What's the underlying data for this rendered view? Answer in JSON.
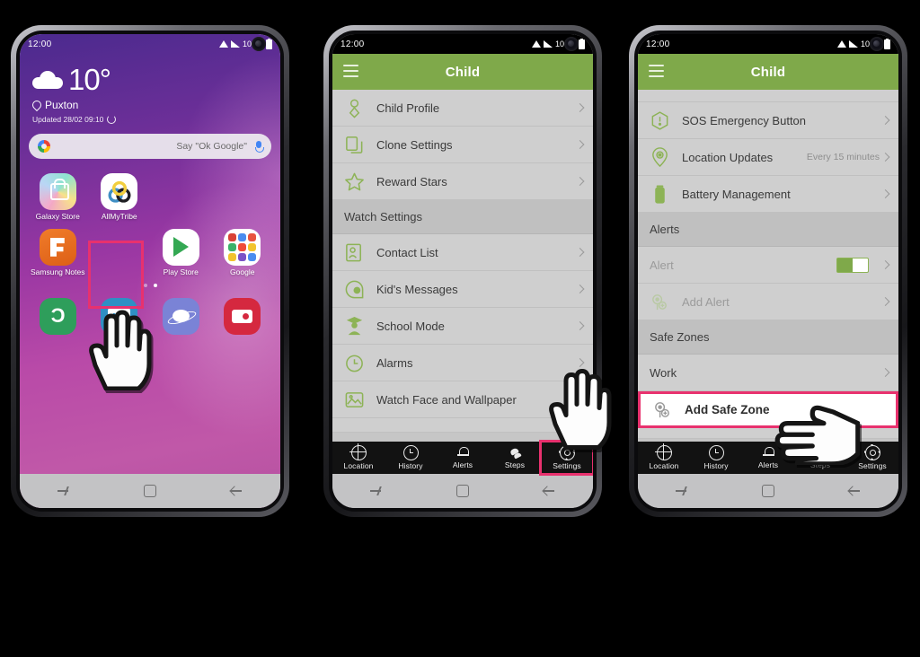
{
  "phone1": {
    "status": {
      "time": "12:00",
      "battery": "100%",
      "icons": [
        "wifi-icon",
        "signal-icon",
        "battery-icon"
      ]
    },
    "weather": {
      "temp": "10°",
      "location": "Puxton",
      "updated": "Updated 28/02 09:10",
      "condition_icon": "cloud-icon"
    },
    "search": {
      "placeholder": "Say \"Ok Google\"",
      "logo": "google-g-icon",
      "mic": "microphone-icon"
    },
    "apps": [
      {
        "label": "Galaxy Store",
        "icon": "galaxy-store-icon"
      },
      {
        "label": "AllMyTribe",
        "icon": "allmytribe-icon",
        "highlighted": true
      },
      {
        "label": "Samsung Notes",
        "icon": "samsung-notes-icon"
      },
      {
        "label": "Play Store",
        "icon": "play-store-icon"
      },
      {
        "label": "Google",
        "icon": "google-folder-icon"
      }
    ],
    "dock": [
      {
        "label": "Phone",
        "icon": "phone-icon"
      },
      {
        "label": "Messages",
        "icon": "messages-icon"
      },
      {
        "label": "Internet",
        "icon": "internet-icon"
      },
      {
        "label": "Camera",
        "icon": "camera-icon"
      }
    ],
    "page_dots": 2,
    "nav": [
      "recents-icon",
      "home-icon",
      "back-icon"
    ]
  },
  "phone2": {
    "status": {
      "time": "12:00",
      "battery": "100%"
    },
    "appbar": {
      "title": "Child",
      "menu_icon": "hamburger-menu-icon"
    },
    "rows": [
      {
        "label": "Child Profile",
        "icon": "child-profile-icon",
        "type": "item"
      },
      {
        "label": "Clone Settings",
        "icon": "clone-settings-icon",
        "type": "item"
      },
      {
        "label": "Reward Stars",
        "icon": "reward-stars-icon",
        "type": "item"
      },
      {
        "label": "Watch Settings",
        "type": "section"
      },
      {
        "label": "Contact List",
        "icon": "contact-list-icon",
        "type": "item"
      },
      {
        "label": "Kid's Messages",
        "icon": "kids-messages-icon",
        "type": "item"
      },
      {
        "label": "School Mode",
        "icon": "school-mode-icon",
        "type": "item"
      },
      {
        "label": "Alarms",
        "icon": "alarms-icon",
        "type": "item"
      },
      {
        "label": "Watch Face and Wallpaper",
        "icon": "watch-face-icon",
        "type": "item"
      }
    ],
    "tabs": [
      {
        "label": "Location",
        "icon": "location-icon"
      },
      {
        "label": "History",
        "icon": "history-icon"
      },
      {
        "label": "Alerts",
        "icon": "alerts-icon"
      },
      {
        "label": "Steps",
        "icon": "steps-icon"
      },
      {
        "label": "Settings",
        "icon": "settings-gear-icon",
        "selected": true
      }
    ]
  },
  "phone3": {
    "status": {
      "time": "12:00",
      "battery": "100%"
    },
    "appbar": {
      "title": "Child",
      "menu_icon": "hamburger-menu-icon"
    },
    "rows": [
      {
        "label": "SOS Emergency Button",
        "icon": "sos-icon",
        "type": "item"
      },
      {
        "label": "Location Updates",
        "icon": "location-pin-icon",
        "value": "Every 15 minutes",
        "type": "item"
      },
      {
        "label": "Battery Management",
        "icon": "battery-icon",
        "type": "item"
      },
      {
        "label": "Alerts",
        "type": "section"
      },
      {
        "label": "Alert",
        "type": "toggle",
        "toggle_on": true
      },
      {
        "label": "Add Alert",
        "icon": "add-alert-icon",
        "type": "item",
        "dim": true
      },
      {
        "label": "Safe Zones",
        "type": "section"
      },
      {
        "label": "Work",
        "type": "item"
      },
      {
        "label": "Add Safe Zone",
        "icon": "add-safe-zone-icon",
        "type": "item",
        "highlighted": true
      }
    ],
    "tabs": [
      {
        "label": "Location",
        "icon": "location-icon"
      },
      {
        "label": "History",
        "icon": "history-icon"
      },
      {
        "label": "Alerts",
        "icon": "alerts-icon"
      },
      {
        "label": "Steps",
        "icon": "steps-icon"
      },
      {
        "label": "Settings",
        "icon": "settings-gear-icon"
      }
    ]
  },
  "colors": {
    "accent_green": "#7fa94a",
    "highlight_pink": "#e8316e",
    "list_bg": "#cfcfcf",
    "tabbar_bg": "#121212"
  }
}
